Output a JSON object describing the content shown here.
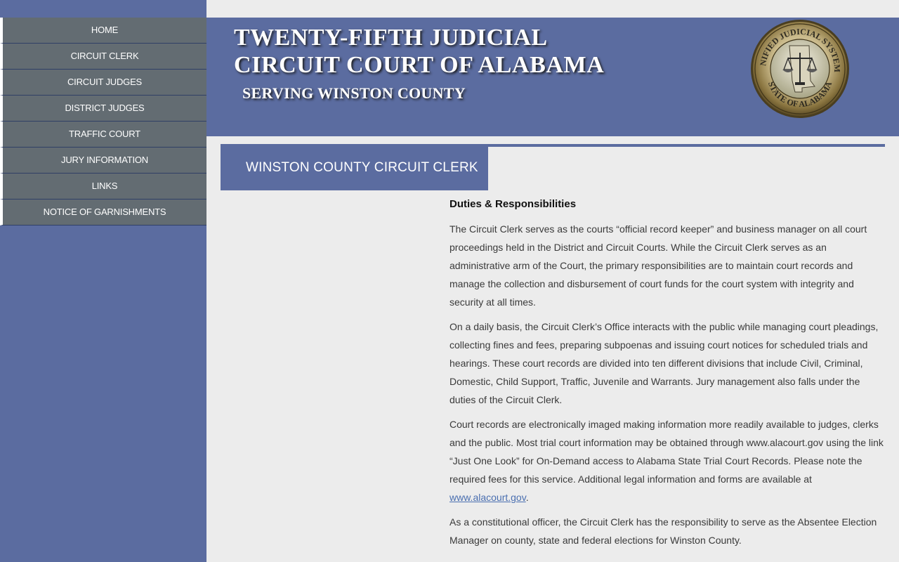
{
  "nav": {
    "items": [
      {
        "label": "HOME"
      },
      {
        "label": "CIRCUIT CLERK"
      },
      {
        "label": "CIRCUIT JUDGES"
      },
      {
        "label": "DISTRICT JUDGES"
      },
      {
        "label": "TRAFFIC COURT"
      },
      {
        "label": "JURY INFORMATION"
      },
      {
        "label": "LINKS"
      },
      {
        "label": "NOTICE OF GARNISHMENTS"
      }
    ]
  },
  "header": {
    "line1": "TWENTY-FIFTH JUDICIAL",
    "line2": "CIRCUIT COURT OF ALABAMA",
    "line3": "SERVING WINSTON COUNTY",
    "seal": {
      "top_text": "UNIFIED JUDICIAL SYSTEM",
      "bottom_text": "STATE OF ALABAMA",
      "icon": "scales-of-justice-icon"
    }
  },
  "page": {
    "title": "WINSTON COUNTY CIRCUIT CLERK"
  },
  "content": {
    "heading": "Duties & Responsibilities",
    "p1": "The Circuit Clerk serves as the courts “official record keeper” and business manager on all court proceedings held in the District and Circuit Courts. While the Circuit Clerk serves as an administrative arm of the Court, the primary responsibilities are to maintain court records and manage the collection and disbursement of court funds for the court system with integrity and security at all times.",
    "p2": "On a daily basis, the Circuit Clerk’s Office interacts with the public while managing court pleadings, collecting fines and fees, preparing subpoenas and issuing court notices for scheduled trials and hearings. These court records are divided into ten different divisions that include Civil, Criminal, Domestic, Child Support, Traffic, Juvenile and Warrants. Jury management also falls under the duties of the Circuit Clerk.",
    "p3": "Court records are electronically imaged making information more readily available to judges, clerks and the public. Most trial court information may be obtained through www.alacourt.gov using the link “Just One Look” for On-Demand access to Alabama State Trial Court Records. Please note the required fees for this service. Additional legal information and forms are available at",
    "p3_link": "www.alacourt.gov",
    "p3_end": ".",
    "p4": "As a constitutional officer, the Circuit Clerk has the responsibility to serve as the Absentee Election Manager on county, state and federal elections for Winston County."
  },
  "colors": {
    "brand_blue": "#5b6ca0",
    "nav_gray": "#636c72",
    "content_bg": "#ececec",
    "link": "#4a6fb0"
  }
}
